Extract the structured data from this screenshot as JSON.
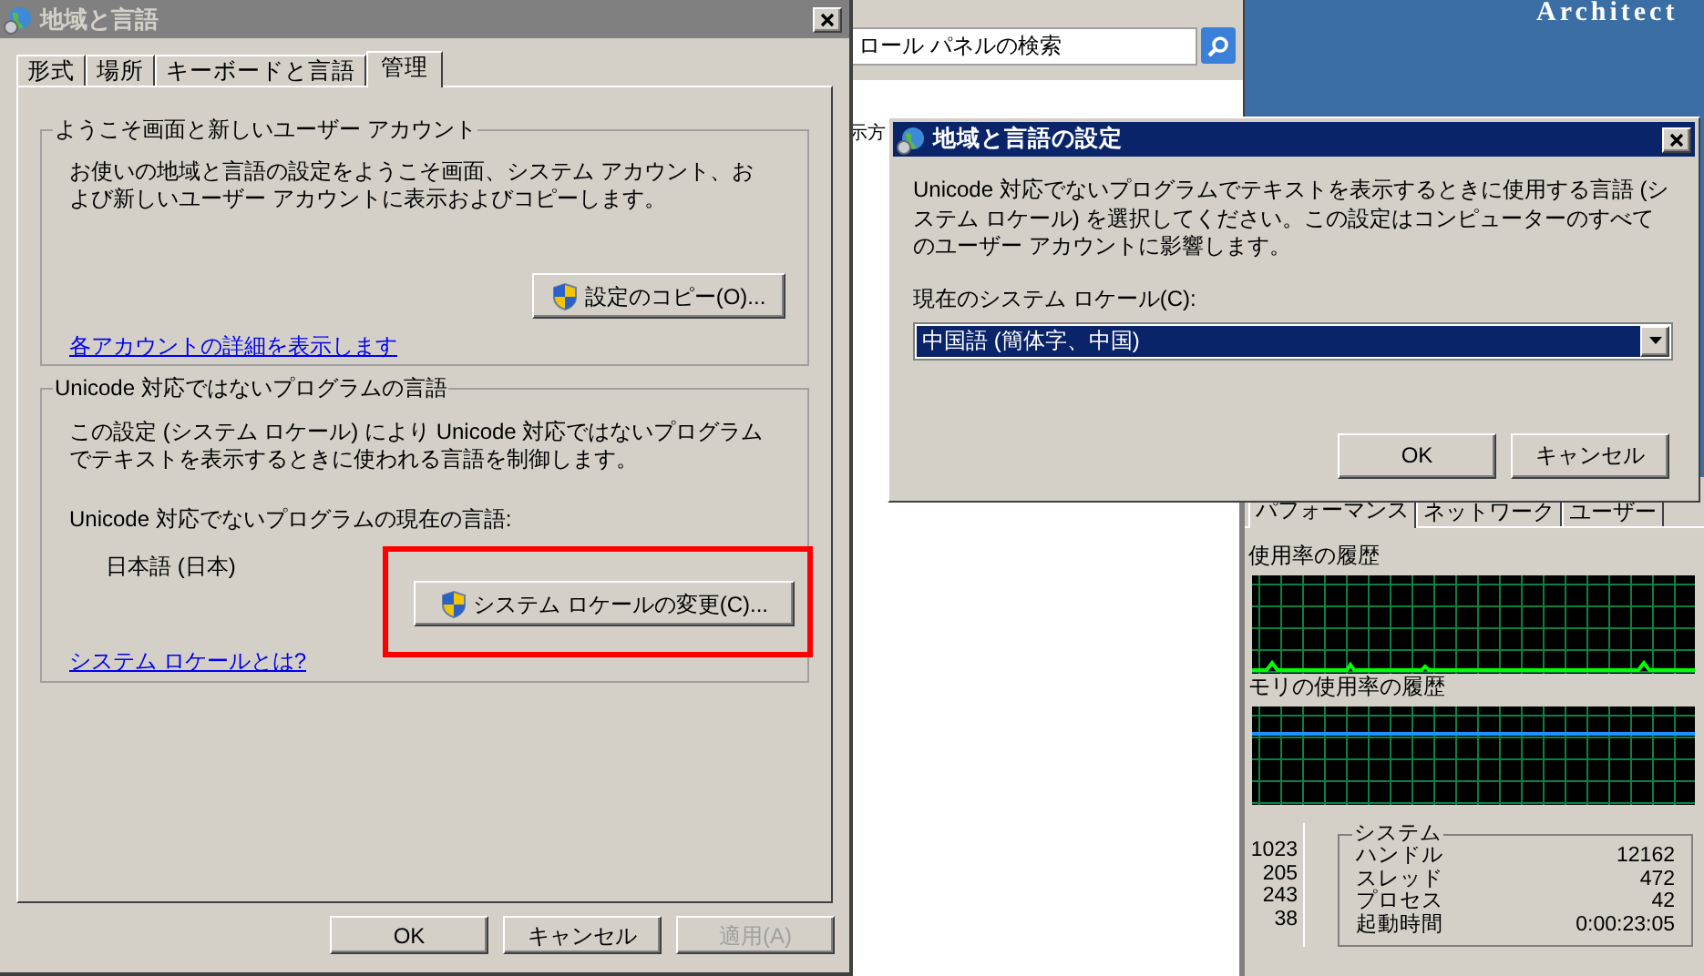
{
  "desktop": {
    "banner_text": "Architect"
  },
  "region_dialog": {
    "title": "地域と言語",
    "tabs": [
      {
        "label": "形式",
        "selected": false
      },
      {
        "label": "場所",
        "selected": false
      },
      {
        "label": "キーボードと言語",
        "selected": false
      },
      {
        "label": "管理",
        "selected": true
      }
    ],
    "welcome_group": {
      "legend": "ようこそ画面と新しいユーザー アカウント",
      "description": "お使いの地域と言語の設定をようこそ画面、システム アカウント、および新しいユーザー アカウントに表示およびコピーします。",
      "copy_button": "設定のコピー(O)...",
      "link": "各アカウントの詳細を表示します"
    },
    "unicode_group": {
      "legend": "Unicode 対応ではないプログラムの言語",
      "description": "この設定 (システム ロケール) により Unicode 対応ではないプログラムでテキストを表示するときに使われる言語を制御します。",
      "current_label": "Unicode 対応でないプログラムの現在の言語:",
      "current_language": "日本語 (日本)",
      "change_button": {
        "label": "システム ロケールの変更(C)...",
        "highlighted": true
      },
      "link": "システム ロケールとは?"
    },
    "buttons": [
      {
        "label": "OK",
        "disabled": false
      },
      {
        "label": "キャンセル",
        "disabled": false
      },
      {
        "label": "適用(A)",
        "disabled": true
      }
    ]
  },
  "control_panel": {
    "search": {
      "placeholder": "ロール パネルの検索"
    },
    "content_text": "示方"
  },
  "locale_dialog": {
    "title": "地域と言語の設定",
    "description": "Unicode 対応でないプログラムでテキストを表示するときに使用する言語 (システム ロケール) を選択してください。この設定はコンピューターのすべてのユーザー アカウントに影響します。",
    "label": "現在のシステム ロケール(C):",
    "selected_locale": "中国語 (簡体字、中国)",
    "buttons": [
      "OK",
      "キャンセル"
    ]
  },
  "task_manager": {
    "tabs": [
      {
        "label": "パフォーマンス",
        "selected": true
      },
      {
        "label": "ネットワーク",
        "selected": false
      },
      {
        "label": "ユーザー",
        "selected": false
      }
    ],
    "cpu_history_title": "使用率の履歴",
    "memory_history_title": "モリの使用率の履歴",
    "left_values": [
      "1023",
      "205",
      "243",
      "38"
    ],
    "system": {
      "legend": "システム",
      "rows": [
        {
          "label": "ハンドル",
          "value": "12162"
        },
        {
          "label": "スレッド",
          "value": "472"
        },
        {
          "label": "プロセス",
          "value": "42"
        },
        {
          "label": "起動時間",
          "value": "0:00:23:05"
        }
      ]
    }
  }
}
